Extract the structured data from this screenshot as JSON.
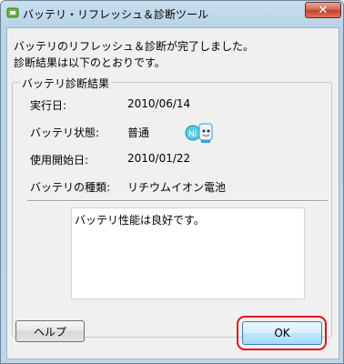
{
  "window": {
    "title": "バッテリ・リフレッシュ＆診断ツール",
    "close_label": "✕"
  },
  "message": {
    "line1": "バッテリのリフレッシュ＆診断が完了しました。",
    "line2": "診断結果は以下のとおりです。"
  },
  "group": {
    "label": "バッテリ診断結果",
    "rows": [
      {
        "label": "実行日:",
        "value": "2010/06/14"
      },
      {
        "label": "バッテリ状態:",
        "value": "普通"
      },
      {
        "label": "使用開始日:",
        "value": "2010/01/22"
      },
      {
        "label": "バッテリの種類:",
        "value": "リチウムイオン電池"
      }
    ],
    "status_icon": "battery-status-icon",
    "result_text": "バッテリ性能は良好です。"
  },
  "buttons": {
    "help_label": "ヘルプ",
    "ok_label": "OK"
  },
  "colors": {
    "highlight": "#e0121b"
  }
}
